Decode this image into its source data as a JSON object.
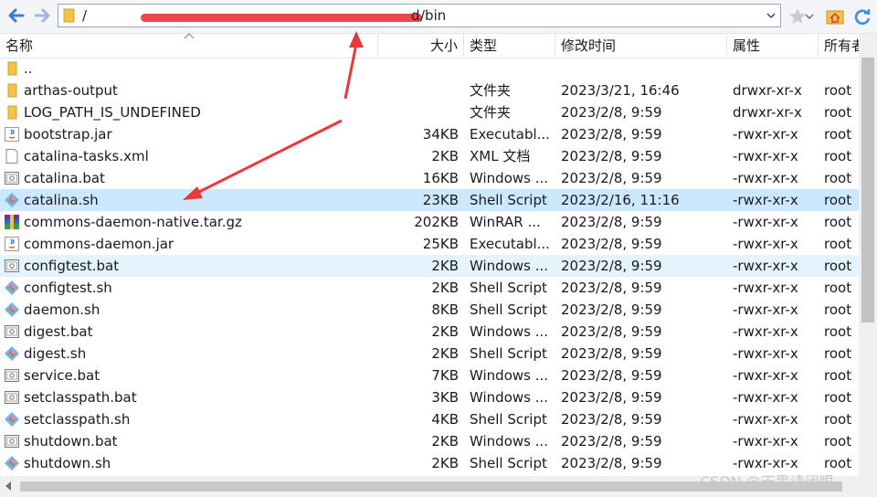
{
  "toolbar": {
    "back_icon": "back-arrow-icon",
    "forward_icon": "forward-arrow-icon",
    "address_path_visible": "/bin",
    "address_prefix_visible": "/",
    "address_d_visible": "d"
  },
  "columns": {
    "name": "名称",
    "size": "大小",
    "type": "类型",
    "modified": "修改时间",
    "attributes": "属性",
    "owner": "所有者"
  },
  "files": [
    {
      "name": "..",
      "size": "",
      "type": "",
      "modified": "",
      "perm": "",
      "owner": "",
      "icon": "folder-icon"
    },
    {
      "name": "arthas-output",
      "size": "",
      "type": "文件夹",
      "modified": "2023/3/21, 16:46",
      "perm": "drwxr-xr-x",
      "owner": "root",
      "icon": "folder-icon"
    },
    {
      "name": "LOG_PATH_IS_UNDEFINED",
      "size": "",
      "type": "文件夹",
      "modified": "2023/2/8, 9:59",
      "perm": "drwxr-xr-x",
      "owner": "root",
      "icon": "folder-icon"
    },
    {
      "name": "bootstrap.jar",
      "size": "34KB",
      "type": "Executabl...",
      "modified": "2023/2/8, 9:59",
      "perm": "-rwxr-xr-x",
      "owner": "root",
      "icon": "java-jar-icon"
    },
    {
      "name": "catalina-tasks.xml",
      "size": "2KB",
      "type": "XML 文档",
      "modified": "2023/2/8, 9:59",
      "perm": "-rwxr-xr-x",
      "owner": "root",
      "icon": "document-icon"
    },
    {
      "name": "catalina.bat",
      "size": "16KB",
      "type": "Windows ...",
      "modified": "2023/2/8, 9:59",
      "perm": "-rwxr-xr-x",
      "owner": "root",
      "icon": "batch-file-icon"
    },
    {
      "name": "catalina.sh",
      "size": "23KB",
      "type": "Shell Script",
      "modified": "2023/2/16, 11:16",
      "perm": "-rwxr-xr-x",
      "owner": "root",
      "icon": "shell-script-icon"
    },
    {
      "name": "commons-daemon-native.tar.gz",
      "size": "202KB",
      "type": "WinRAR ...",
      "modified": "2023/2/8, 9:59",
      "perm": "-rwxr-xr-x",
      "owner": "root",
      "icon": "winrar-archive-icon"
    },
    {
      "name": "commons-daemon.jar",
      "size": "25KB",
      "type": "Executabl...",
      "modified": "2023/2/8, 9:59",
      "perm": "-rwxr-xr-x",
      "owner": "root",
      "icon": "java-jar-icon"
    },
    {
      "name": "configtest.bat",
      "size": "2KB",
      "type": "Windows ...",
      "modified": "2023/2/8, 9:59",
      "perm": "-rwxr-xr-x",
      "owner": "root",
      "icon": "batch-file-icon"
    },
    {
      "name": "configtest.sh",
      "size": "2KB",
      "type": "Shell Script",
      "modified": "2023/2/8, 9:59",
      "perm": "-rwxr-xr-x",
      "owner": "root",
      "icon": "shell-script-icon"
    },
    {
      "name": "daemon.sh",
      "size": "8KB",
      "type": "Shell Script",
      "modified": "2023/2/8, 9:59",
      "perm": "-rwxr-xr-x",
      "owner": "root",
      "icon": "shell-script-icon"
    },
    {
      "name": "digest.bat",
      "size": "2KB",
      "type": "Windows ...",
      "modified": "2023/2/8, 9:59",
      "perm": "-rwxr-xr-x",
      "owner": "root",
      "icon": "batch-file-icon"
    },
    {
      "name": "digest.sh",
      "size": "2KB",
      "type": "Shell Script",
      "modified": "2023/2/8, 9:59",
      "perm": "-rwxr-xr-x",
      "owner": "root",
      "icon": "shell-script-icon"
    },
    {
      "name": "service.bat",
      "size": "7KB",
      "type": "Windows ...",
      "modified": "2023/2/8, 9:59",
      "perm": "-rwxr-xr-x",
      "owner": "root",
      "icon": "batch-file-icon"
    },
    {
      "name": "setclasspath.bat",
      "size": "3KB",
      "type": "Windows ...",
      "modified": "2023/2/8, 9:59",
      "perm": "-rwxr-xr-x",
      "owner": "root",
      "icon": "batch-file-icon"
    },
    {
      "name": "setclasspath.sh",
      "size": "4KB",
      "type": "Shell Script",
      "modified": "2023/2/8, 9:59",
      "perm": "-rwxr-xr-x",
      "owner": "root",
      "icon": "shell-script-icon"
    },
    {
      "name": "shutdown.bat",
      "size": "2KB",
      "type": "Windows ...",
      "modified": "2023/2/8, 9:59",
      "perm": "-rwxr-xr-x",
      "owner": "root",
      "icon": "batch-file-icon"
    },
    {
      "name": "shutdown.sh",
      "size": "2KB",
      "type": "Shell Script",
      "modified": "2023/2/8, 9:59",
      "perm": "-rwxr-xr-x",
      "owner": "root",
      "icon": "shell-script-icon"
    }
  ],
  "selected_file": "catalina.sh",
  "hovered_file": "configtest.bat",
  "watermark": "CSDN @天黑请闭眼",
  "colors": {
    "selected_row": "#cce8ff",
    "hover_row": "#e5f3ff",
    "annotation_arrow": "#e8383c",
    "nav_arrow": "#3a7bd5"
  }
}
